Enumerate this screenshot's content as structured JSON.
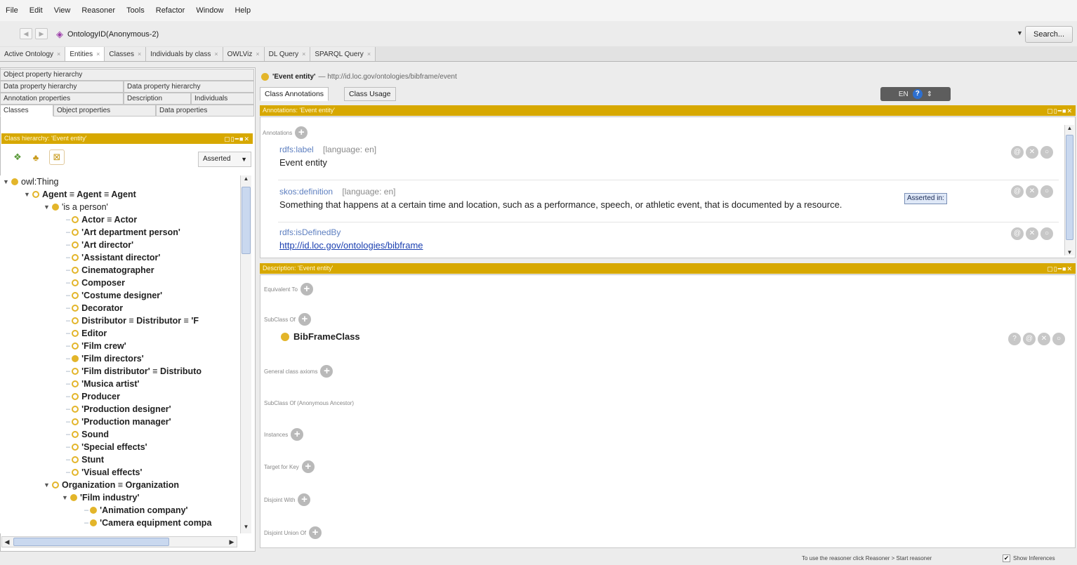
{
  "menu": [
    "File",
    "Edit",
    "View",
    "Reasoner",
    "Tools",
    "Refactor",
    "Window",
    "Help"
  ],
  "address": {
    "back": "◀",
    "forward": "▶",
    "ontology_id": "OntologyID(Anonymous-2)",
    "search_label": "Search..."
  },
  "tabs": [
    {
      "label": "Active Ontology"
    },
    {
      "label": "Entities"
    },
    {
      "label": "Classes"
    },
    {
      "label": "Individuals by class"
    },
    {
      "label": "OWLViz"
    },
    {
      "label": "DL Query"
    },
    {
      "label": "SPARQL Query"
    }
  ],
  "left": {
    "row1": [
      "Object property hierarchy"
    ],
    "row2": [
      "Data property hierarchy",
      "Data property hierarchy"
    ],
    "row3": [
      "Annotation properties",
      "Description",
      "Individuals"
    ],
    "row4": [
      "Classes",
      "Object properties",
      "Data properties"
    ],
    "hierarchy_title": "Class hierarchy: 'Event entity'",
    "asserted": "Asserted"
  },
  "tree": [
    {
      "label": "owl:Thing",
      "ring": false,
      "tog": "▼"
    },
    {
      "label": "Agent ≡ Agent ≡ Agent",
      "ring": true,
      "tog": "▼"
    },
    {
      "label": "'is a person'",
      "ring": false,
      "tog": "▼"
    },
    {
      "label": "Actor ≡ Actor",
      "ring": true
    },
    {
      "label": "'Art department person'",
      "ring": true
    },
    {
      "label": "'Art director'",
      "ring": true
    },
    {
      "label": "'Assistant director'",
      "ring": true
    },
    {
      "label": "Cinematographer",
      "ring": true
    },
    {
      "label": "Composer",
      "ring": true
    },
    {
      "label": "'Costume designer'",
      "ring": true
    },
    {
      "label": "Decorator",
      "ring": true
    },
    {
      "label": "Distributor ≡ Distributor ≡ 'F",
      "ring": true
    },
    {
      "label": "Editor",
      "ring": true
    },
    {
      "label": "'Film crew'",
      "ring": true
    },
    {
      "label": "'Film directors'",
      "ring": false
    },
    {
      "label": "'Film distributor' ≡ Distributo",
      "ring": true
    },
    {
      "label": "'Musica artist'",
      "ring": true
    },
    {
      "label": "Producer",
      "ring": true
    },
    {
      "label": "'Production designer'",
      "ring": true
    },
    {
      "label": "'Production manager'",
      "ring": true
    },
    {
      "label": "Sound",
      "ring": true
    },
    {
      "label": "'Special effects'",
      "ring": true
    },
    {
      "label": "Stunt",
      "ring": true
    },
    {
      "label": "'Visual effects'",
      "ring": true
    },
    {
      "label": "Organization ≡ Organization",
      "ring": true,
      "tog": "▼"
    },
    {
      "label": "'Film industry'",
      "ring": false,
      "tog": "▼"
    },
    {
      "label": "'Animation company'",
      "ring": false
    },
    {
      "label": "'Camera equipment compa",
      "ring": false
    }
  ],
  "right": {
    "entity_name": "'Event entity'",
    "entity_iri": "— http://id.loc.gov/ontologies/bibframe/event",
    "class_tabs": [
      "Class Annotations",
      "Class Usage"
    ],
    "lang_label": "EN",
    "annotations_bar": "Annotations: 'Event entity'",
    "annotations_label": "Annotations",
    "annotations": [
      {
        "prop": "rdfs:label",
        "lang": "[language: en]",
        "value": "Event entity",
        "link": false
      },
      {
        "prop": "skos:definition",
        "lang": "[language: en]",
        "value": "Something that happens at a certain time and location, such as a performance, speech, or athletic event, that is documented by a resource.",
        "link": false
      },
      {
        "prop": "rdfs:isDefinedBy",
        "lang": "",
        "value": "http://id.loc.gov/ontologies/bibframe",
        "link": true
      }
    ],
    "asserted_tooltip": "Asserted in:",
    "description_bar": "Description: 'Event entity'",
    "sections": [
      "Equivalent To",
      "SubClass Of",
      "General class axioms",
      "SubClass Of (Anonymous Ancestor)",
      "Instances",
      "Target for Key",
      "Disjoint With",
      "Disjoint Union Of"
    ],
    "subclass_value": "BibFrameClass"
  },
  "status": {
    "message": "To use the reasoner click Reasoner > Start reasoner",
    "show_inferences": "Show Inferences",
    "checked": "✔"
  },
  "colors": {
    "accent": "#d7a800",
    "class_dot": "#e3b52a",
    "link": "#1a3fb0"
  }
}
